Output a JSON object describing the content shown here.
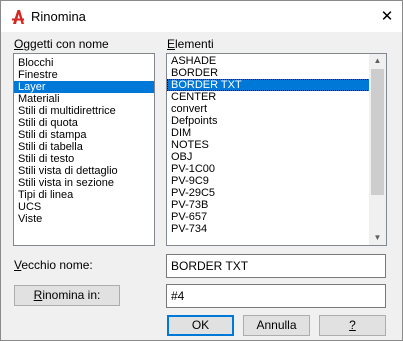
{
  "window": {
    "title": "Rinomina",
    "close_glyph": "✕",
    "icon": "autocad-icon"
  },
  "objects": {
    "label_accel": "O",
    "label_rest": "ggetti con nome",
    "items": [
      "Blocchi",
      "Finestre",
      "Layer",
      "Materiali",
      "Stili di multidirettrice",
      "Stili di quota",
      "Stili di stampa",
      "Stili di tabella",
      "Stili di testo",
      "Stili vista di dettaglio",
      "Stili vista in sezione",
      "Tipi di linea",
      "UCS",
      "Viste"
    ],
    "selected": "Layer"
  },
  "elements": {
    "label_accel": "E",
    "label_rest": "lementi",
    "items": [
      "ASHADE",
      "BORDER",
      "BORDER TXT",
      "CENTER",
      "convert",
      "Defpoints",
      "DIM",
      "NOTES",
      "OBJ",
      "PV-1C00",
      "PV-9C9",
      "PV-29C5",
      "PV-73B",
      "PV-657",
      "PV-734"
    ],
    "selected": "BORDER TXT",
    "scroll_up": "▲",
    "scroll_down": "▼"
  },
  "old_name": {
    "label_accel": "V",
    "label_rest": "ecchio nome:",
    "value": "BORDER TXT"
  },
  "rename_to": {
    "button_accel": "R",
    "button_rest": "inomina in:",
    "value": "#4"
  },
  "buttons": {
    "ok": "OK",
    "cancel": "Annulla",
    "help": "?"
  },
  "colors": {
    "selection": "#0078d7",
    "app_icon": "#d6261f"
  }
}
